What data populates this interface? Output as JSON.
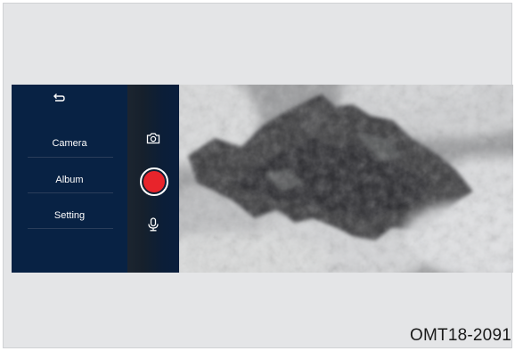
{
  "menu": {
    "back_icon": "back-arrow-icon",
    "items": [
      {
        "label": "Camera"
      },
      {
        "label": "Album"
      },
      {
        "label": "Setting"
      }
    ]
  },
  "controls": {
    "camera_icon": "camera-icon",
    "record_icon": "record-icon",
    "microphone_icon": "microphone-icon",
    "record_color": "#e8242b"
  },
  "preview": {
    "description_icon": "camera-preview"
  },
  "caption": "OMT18-2091"
}
